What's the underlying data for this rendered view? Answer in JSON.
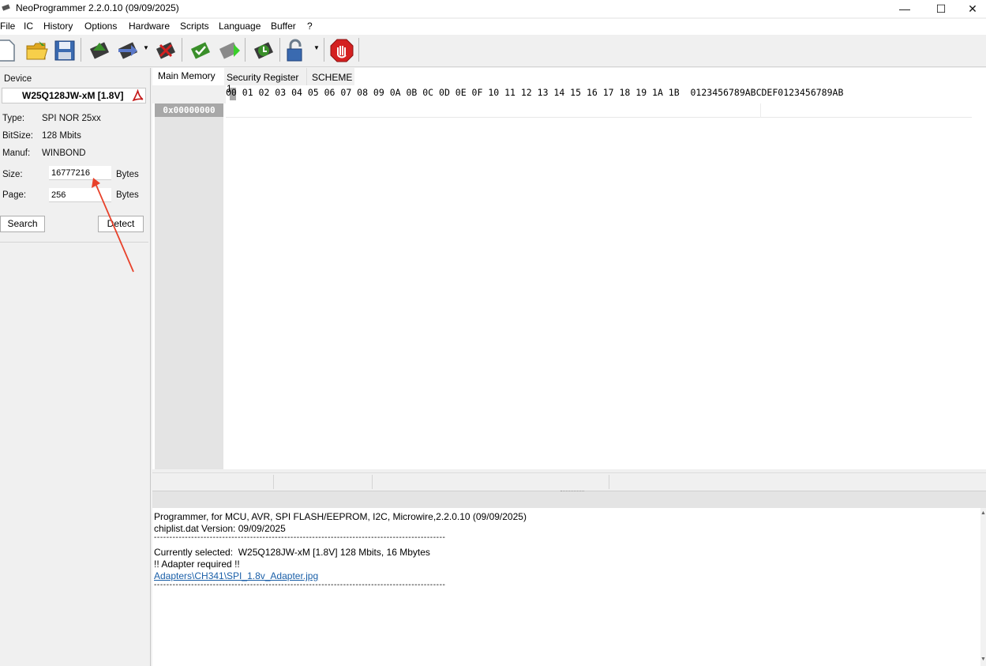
{
  "window": {
    "title": "NeoProgrammer 2.2.0.10 (09/09/2025)",
    "minimize": "—",
    "maximize": "☐",
    "close": "✕"
  },
  "menu": [
    "File",
    "IC",
    "History",
    "Options",
    "Hardware",
    "Scripts",
    "Language",
    "Buffer",
    "?"
  ],
  "toolbar": {
    "icons": [
      "new-file-icon",
      "open-folder-icon",
      "save-icon",
      "read-chip-icon",
      "write-chip-icon",
      "erase-chip-icon",
      "verify-chip-icon",
      "blank-check-icon",
      "auto-chip-icon",
      "lock-icon",
      "stop-icon"
    ]
  },
  "device": {
    "section_label": "Device",
    "name": "W25Q128JW-xM [1.8V]",
    "type_label": "Type:",
    "type_value": "SPI NOR 25xx",
    "bitsize_label": "BitSize:",
    "bitsize_value": "128 Mbits",
    "manuf_label": "Manuf:",
    "manuf_value": "WINBOND",
    "size_label": "Size:",
    "size_value": "16777216",
    "size_unit": "Bytes",
    "page_label": "Page:",
    "page_value": "256",
    "page_unit": "Bytes",
    "search_button": "Search",
    "detect_button": "Detect"
  },
  "tabs": [
    "Main Memory",
    "Security Register 1",
    "SCHEME"
  ],
  "hex": {
    "header": "00 01 02 03 04 05 06 07 08 09 0A 0B 0C 0D 0E 0F 10 11 12 13 14 15 16 17 18 19 1A 1B  0123456789ABCDEF0123456789AB",
    "address": "0x00000000"
  },
  "log": {
    "line1": "Programmer, for MCU, AVR, SPI FLASH/EEPROM, I2C, Microwire,2.2.0.10 (09/09/2025)",
    "line2": "chiplist.dat Version: 09/09/2025",
    "separator": "----------------------------------------------------------------------------------------------",
    "line3": "Currently selected:  W25Q128JW-xM [1.8V] 128 Mbits, 16 Mbytes",
    "line4": "!! Adapter required !!",
    "link": "Adapters\\CH341\\SPI_1.8v_Adapter.jpg"
  },
  "colors": {
    "annotation_arrow": "#e8412a",
    "stop_red": "#d42020",
    "chip_green": "#3a8f2a"
  }
}
